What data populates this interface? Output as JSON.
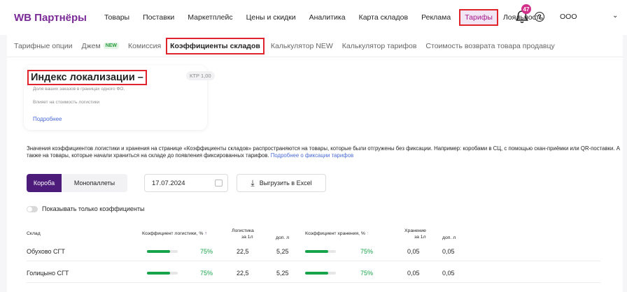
{
  "topnav": {
    "logo": "WB Партнёры",
    "items": [
      "Товары",
      "Поставки",
      "Маркетплейс",
      "Цены и скидки",
      "Аналитика",
      "Карта складов",
      "Реклама",
      "Тарифы",
      "Лояльность"
    ],
    "notification_count": "47",
    "help_glyph": "?",
    "org": "ООО"
  },
  "subnav": {
    "items": [
      "Тарифные опции",
      "Джем",
      "Комиссия",
      "Коэффициенты складов",
      "Калькулятор NEW",
      "Калькулятор тарифов",
      "Стоимость возврата товара продавцу"
    ],
    "new_badge": "NEW"
  },
  "card": {
    "title": "Индекс локализации –",
    "ktr": "КТР 1,00",
    "desc": "Доля ваших заказов в границах одного ФО.",
    "desc2": "Влияет на стоимость логистики",
    "link": "Подробнее"
  },
  "notice": {
    "text": "Значения коэффициентов логистики и хранения на странице «Коэффициенты складов» распространяются на товары, которые были отгружены без фиксации. Например: коробами в СЦ, с помощью скан-приёмки или QR-поставки. А также на товары, которые начали храниться на складе до появления фиксированных тарифов.",
    "link": "Подробнее о фиксации тарифов"
  },
  "controls": {
    "seg_on": "Короба",
    "seg_off": "Монопаллеты",
    "date": "17.07.2024",
    "export": "Выгрузить в Excel",
    "toggle_label": "Показывать только коэффициенты"
  },
  "table": {
    "headers": {
      "warehouse": "Склад",
      "log_coef": "Коэффициент логистики, %",
      "log_per_l": "Логистика",
      "log_per_l_sub": "за 1л",
      "log_extra": "доп. л",
      "store_coef": "Коэффициент хранения, %",
      "store_per_l": "Хранение",
      "store_per_l_sub": "за 1л",
      "store_extra": "доп. л"
    },
    "rows": [
      {
        "warehouse": "Обухово СГТ",
        "log_pct": "75%",
        "log_fill": 0.75,
        "log_l": "22,5",
        "log_extra": "5,25",
        "store_pct": "75%",
        "store_fill": 0.75,
        "store_l": "0,05",
        "store_extra": "0,05"
      },
      {
        "warehouse": "Голицыно СГТ",
        "log_pct": "75%",
        "log_fill": 0.75,
        "log_l": "22,5",
        "log_extra": "5,25",
        "store_pct": "75%",
        "store_fill": 0.75,
        "store_l": "0,05",
        "store_extra": "0,05"
      }
    ]
  },
  "colors": {
    "brand": "#7b2b98",
    "accent_dark": "#4d1c7a",
    "highlight_red": "#e0242c",
    "ok_green": "#17a34a",
    "link": "#4a6ad6"
  }
}
